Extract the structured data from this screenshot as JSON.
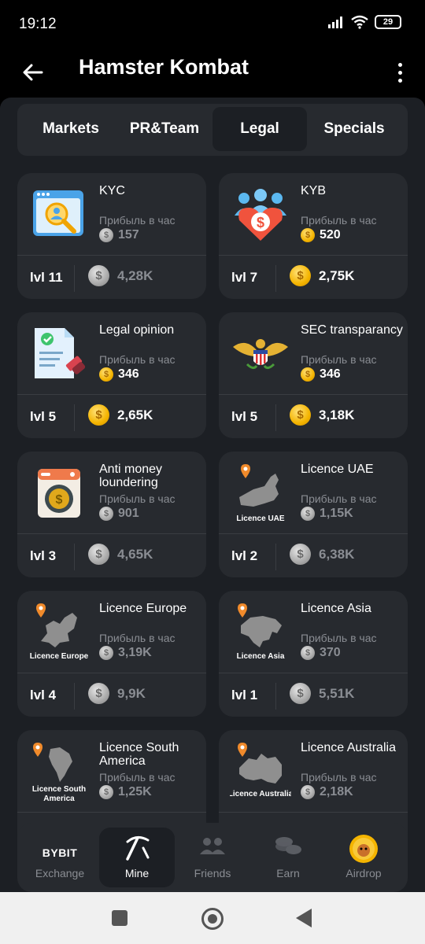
{
  "status": {
    "time": "19:12",
    "battery": "29"
  },
  "app": {
    "title": "Hamster Kombat"
  },
  "tabs": [
    {
      "label": "Markets",
      "active": false
    },
    {
      "label": "PR&Team",
      "active": false
    },
    {
      "label": "Legal",
      "active": true
    },
    {
      "label": "Specials",
      "active": false
    }
  ],
  "profit_label": "Прибыль в час",
  "cards": [
    {
      "title": "KYC",
      "profit": "157",
      "profit_coin": "grey",
      "level": "lvl 11",
      "cost": "4,28K",
      "cost_coin": "grey",
      "icon": "kyc-icon"
    },
    {
      "title": "KYB",
      "profit": "520",
      "profit_coin": "gold",
      "level": "lvl 7",
      "cost": "2,75K",
      "cost_coin": "gold",
      "icon": "kyb-icon"
    },
    {
      "title": "Legal opinion",
      "profit": "346",
      "profit_coin": "gold",
      "level": "lvl 5",
      "cost": "2,65K",
      "cost_coin": "gold",
      "icon": "legal-opinion-icon"
    },
    {
      "title": "SEC transparancy",
      "profit": "346",
      "profit_coin": "gold",
      "level": "lvl 5",
      "cost": "3,18K",
      "cost_coin": "gold",
      "icon": "sec-eagle-icon"
    },
    {
      "title": "Anti money loundering",
      "profit": "901",
      "profit_coin": "grey",
      "level": "lvl 3",
      "cost": "4,65K",
      "cost_coin": "grey",
      "icon": "washing-machine-icon"
    },
    {
      "title": "Licence UAE",
      "profit": "1,15K",
      "profit_coin": "grey",
      "level": "lvl 2",
      "cost": "6,38K",
      "cost_coin": "grey",
      "icon": "map-uae-icon",
      "map_caption": "Licence UAE"
    },
    {
      "title": "Licence Europe",
      "profit": "3,19K",
      "profit_coin": "grey",
      "level": "lvl 4",
      "cost": "9,9K",
      "cost_coin": "grey",
      "icon": "map-europe-icon",
      "map_caption": "Licence Europe"
    },
    {
      "title": "Licence Asia",
      "profit": "370",
      "profit_coin": "grey",
      "level": "lvl 1",
      "cost": "5,51K",
      "cost_coin": "grey",
      "icon": "map-asia-icon",
      "map_caption": "Licence Asia"
    },
    {
      "title": "Licence South America",
      "profit": "1,25K",
      "profit_coin": "grey",
      "level": "",
      "cost": "",
      "cost_coin": "grey",
      "icon": "map-south-america-icon",
      "map_caption": "Licence South America"
    },
    {
      "title": "Licence Australia",
      "profit": "2,18K",
      "profit_coin": "grey",
      "level": "",
      "cost": "",
      "cost_coin": "grey",
      "icon": "map-australia-icon",
      "map_caption": "Licence Australia"
    }
  ],
  "bottom_nav": [
    {
      "label": "Exchange",
      "brand": "BYBIT",
      "active": false
    },
    {
      "label": "Mine",
      "active": true
    },
    {
      "label": "Friends",
      "active": false
    },
    {
      "label": "Earn",
      "active": false
    },
    {
      "label": "Airdrop",
      "active": false
    }
  ],
  "colors": {
    "gold": "#f4b400",
    "card": "#272a2f",
    "background": "#1c1f24",
    "muted": "#8a8d93"
  }
}
